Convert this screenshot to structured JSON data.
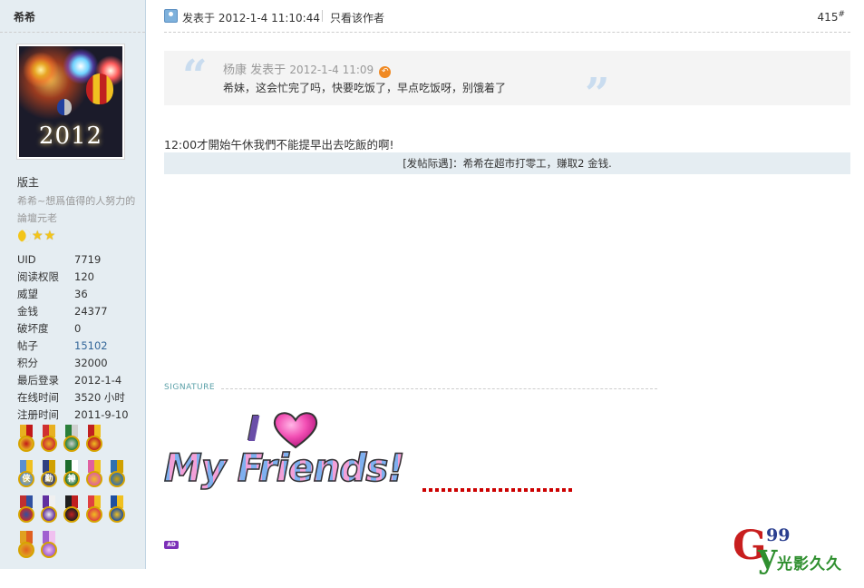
{
  "sidebar": {
    "username": "希希",
    "avatar_text": "2012",
    "rank": "版主",
    "custom_title": "希希~想爲值得的人努力的論壇元老",
    "stats": [
      {
        "label": "UID",
        "value": "7719"
      },
      {
        "label": "阅读权限",
        "value": "120"
      },
      {
        "label": "威望",
        "value": "36"
      },
      {
        "label": "金钱",
        "value": "24377"
      },
      {
        "label": "破坏度",
        "value": "0"
      },
      {
        "label": "帖子",
        "value": "15102"
      },
      {
        "label": "积分",
        "value": "32000"
      },
      {
        "label": "最后登录",
        "value": "2012-1-4"
      },
      {
        "label": "在线时间",
        "value": "3520 小时"
      },
      {
        "label": "注册时间",
        "value": "2011-9-10"
      }
    ],
    "medals_rows": [
      4,
      5,
      5,
      2
    ],
    "medal_glyphs": [
      "勤",
      "侠",
      "神"
    ]
  },
  "post": {
    "posted_at": "发表于 2012-1-4 11:10:44",
    "only_author": "只看该作者",
    "floor": "415",
    "floor_mark": "#",
    "quote": {
      "author": "杨康",
      "posted_label": "发表于",
      "time": "2012-1-4 11:09",
      "text": "希妹，这会忙完了吗，快要吃饭了，早点吃饭呀，别饿着了"
    },
    "body": "12:00才開始午休我們不能提早出去吃飯的啊!",
    "rate_notice": "[发帖际遇]：希希在超市打零工，赚取2 金钱."
  },
  "signature": {
    "label": "SIGNATURE",
    "image_text_top": "I",
    "image_text_bottom": "My Friends!"
  },
  "ad_label": "AD",
  "watermark": {
    "g": "G",
    "num": "99",
    "y": "y",
    "cn": "光影久久"
  },
  "colors": {
    "sidebar_bg": "#e5edf2",
    "link": "#336699",
    "quote_bg": "#f4f4f4",
    "rate_bg": "#e5edf2"
  }
}
